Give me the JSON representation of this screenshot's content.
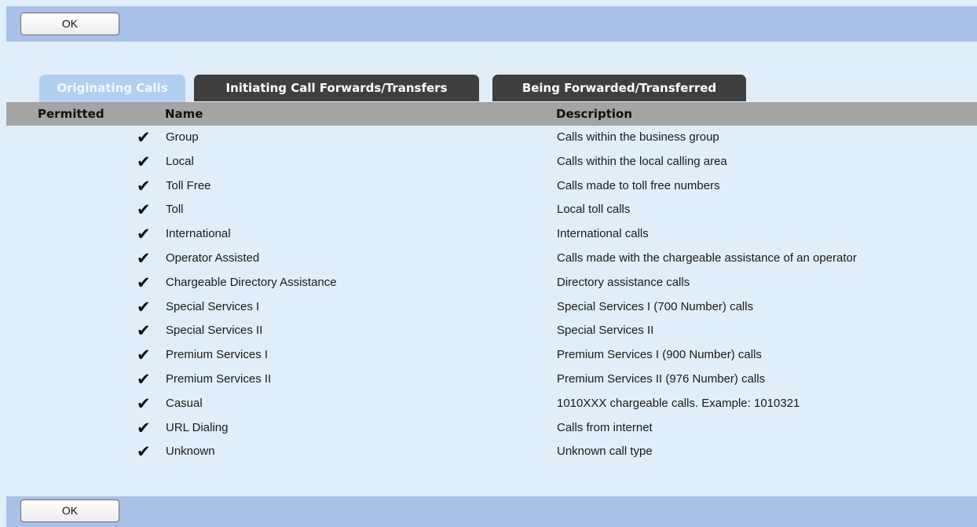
{
  "buttons": {
    "ok_top": "OK",
    "ok_bottom": "OK"
  },
  "tabs": [
    {
      "label": "Originating Calls",
      "active": true
    },
    {
      "label": "Initiating Call Forwards/Transfers",
      "active": false
    },
    {
      "label": "Being Forwarded/Transferred",
      "active": false
    }
  ],
  "table": {
    "headers": {
      "permitted": "Permitted",
      "name": "Name",
      "description": "Description"
    },
    "check_glyph": "✔",
    "rows": [
      {
        "name": "Group",
        "description": "Calls within the business group",
        "permitted": true
      },
      {
        "name": "Local",
        "description": "Calls within the local calling area",
        "permitted": true
      },
      {
        "name": "Toll Free",
        "description": "Calls made to toll free numbers",
        "permitted": true
      },
      {
        "name": "Toll",
        "description": "Local toll calls",
        "permitted": true
      },
      {
        "name": "International",
        "description": "International calls",
        "permitted": true
      },
      {
        "name": "Operator Assisted",
        "description": "Calls made with the chargeable assistance of an operator",
        "permitted": true
      },
      {
        "name": "Chargeable Directory Assistance",
        "description": "Directory assistance calls",
        "permitted": true
      },
      {
        "name": "Special Services I",
        "description": "Special Services I (700 Number) calls",
        "permitted": true
      },
      {
        "name": "Special Services II",
        "description": "Special Services II",
        "permitted": true
      },
      {
        "name": "Premium Services I",
        "description": "Premium Services I (900 Number) calls",
        "permitted": true
      },
      {
        "name": "Premium Services II",
        "description": "Premium Services II (976 Number) calls",
        "permitted": true
      },
      {
        "name": "Casual",
        "description": "1010XXX chargeable calls. Example: 1010321",
        "permitted": true
      },
      {
        "name": "URL Dialing",
        "description": "Calls from internet",
        "permitted": true
      },
      {
        "name": "Unknown",
        "description": "Unknown call type",
        "permitted": true
      }
    ]
  },
  "colors": {
    "page_bg": "#dfeef9",
    "toolbar_bg": "#a9c1e6",
    "active_tab_bg": "#b3cff0",
    "inactive_tab_bg": "#3f3f3f",
    "header_bg": "#a4a4a4"
  }
}
